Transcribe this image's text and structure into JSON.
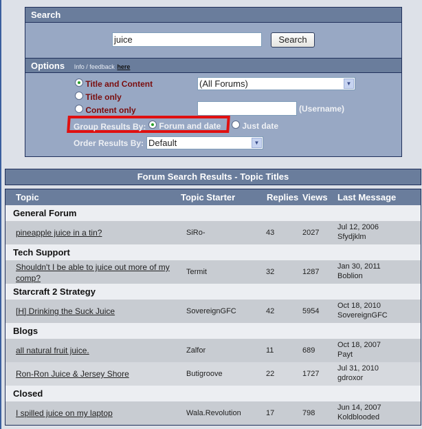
{
  "search": {
    "header": "Search",
    "query": "juice",
    "button": "Search"
  },
  "options": {
    "header": "Options",
    "info_text": "Info / feedback",
    "info_link": "here",
    "scope": [
      {
        "label": "Title and Content",
        "selected": true
      },
      {
        "label": "Title only",
        "selected": false
      },
      {
        "label": "Content only",
        "selected": false
      }
    ],
    "forum_select": "(All Forums)",
    "username_value": "",
    "username_label": "(Username)",
    "group_label": "Group Results By:",
    "group_options": [
      {
        "label": "Forum and date",
        "selected": true
      },
      {
        "label": "Just date",
        "selected": false
      }
    ],
    "order_label": "Order Results By:",
    "order_select": "Default",
    "highlight_color": "#e01010"
  },
  "results": {
    "title": "Forum Search Results - Topic Titles",
    "columns": [
      "Topic",
      "Topic Starter",
      "Replies",
      "Views",
      "Last Message"
    ],
    "groups": [
      {
        "name": "General Forum",
        "topics": [
          {
            "title": "pineapple juice in a tin?",
            "starter": "SiRo-",
            "replies": "43",
            "views": "2027",
            "last_date": "Jul 12, 2006",
            "last_user": "Sfydjklm"
          }
        ]
      },
      {
        "name": "Tech Support",
        "topics": [
          {
            "title": "Shouldn't I be able to juice out more of my comp?",
            "starter": "Termit",
            "replies": "32",
            "views": "1287",
            "last_date": "Jan 30, 2011",
            "last_user": "Boblion"
          }
        ]
      },
      {
        "name": "Starcraft 2 Strategy",
        "topics": [
          {
            "title": "[H] Drinking the Suck Juice",
            "starter": "SovereignGFC",
            "replies": "42",
            "views": "5954",
            "last_date": "Oct 18, 2010",
            "last_user": "SovereignGFC"
          }
        ]
      },
      {
        "name": "Blogs",
        "topics": [
          {
            "title": "all natural fruit juice.",
            "starter": "Zalfor",
            "replies": "11",
            "views": "689",
            "last_date": "Oct 18, 2007",
            "last_user": "Payt"
          },
          {
            "title": "Ron-Ron Juice & Jersey Shore",
            "starter": "Butigroove",
            "replies": "22",
            "views": "1727",
            "last_date": "Jul 31, 2010",
            "last_user": "gdroxor"
          }
        ]
      },
      {
        "name": "Closed",
        "topics": [
          {
            "title": "I spilled juice on my laptop",
            "starter": "Wala.Revolution",
            "replies": "17",
            "views": "798",
            "last_date": "Jun 14, 2007",
            "last_user": "Koldblooded"
          }
        ]
      }
    ]
  }
}
